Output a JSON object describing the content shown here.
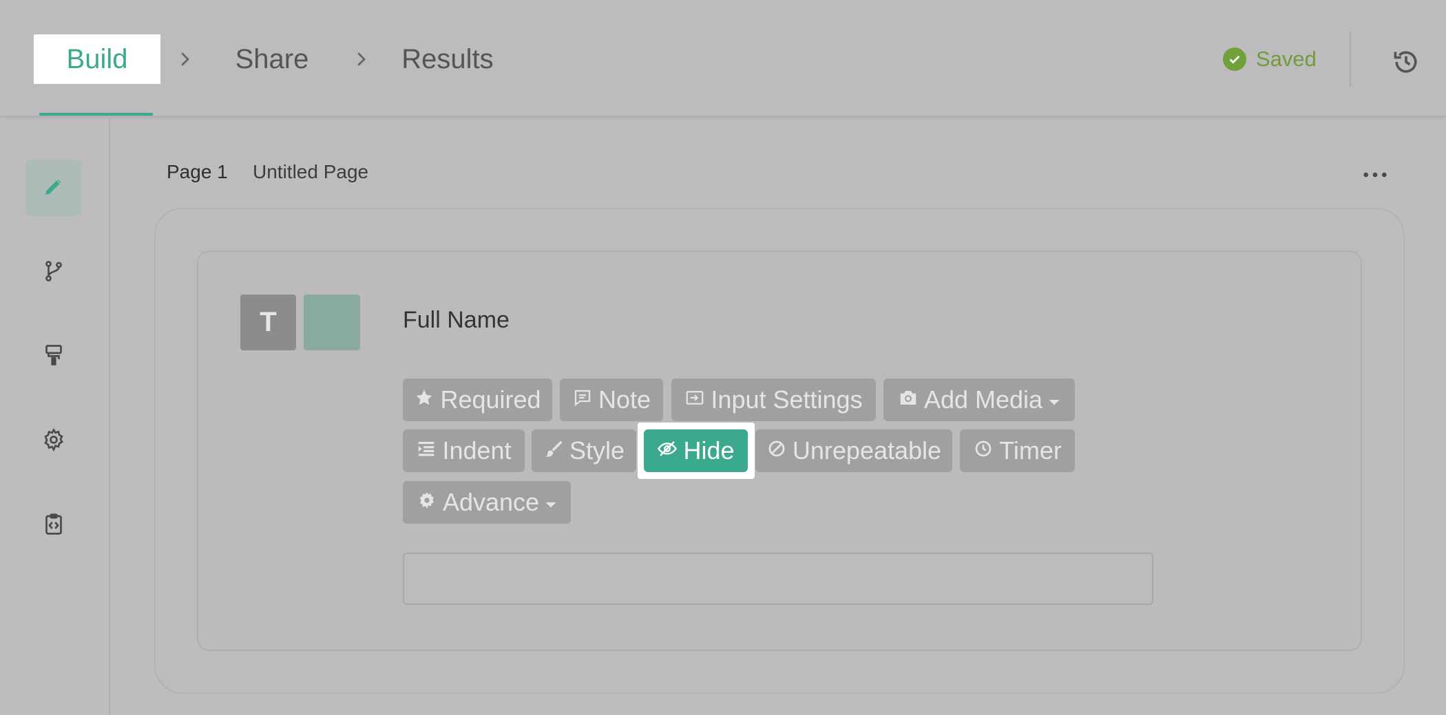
{
  "steps": {
    "build": "Build",
    "share": "Share",
    "results": "Results"
  },
  "status": {
    "saved": "Saved"
  },
  "page": {
    "number_label": "Page 1",
    "title": "Untitled Page"
  },
  "field": {
    "type_letter": "T",
    "label": "Full Name",
    "input_value": ""
  },
  "chips": {
    "required": "Required",
    "note": "Note",
    "input_settings": "Input Settings",
    "add_media": "Add Media",
    "indent": "Indent",
    "style": "Style",
    "hide": "Hide",
    "unrepeatable": "Unrepeatable",
    "timer": "Timer",
    "advance": "Advance"
  },
  "icons": {
    "rail": [
      "pencil-icon",
      "branch-icon",
      "paint-roller-icon",
      "gear-icon",
      "code-clipboard-icon"
    ],
    "saved": "check-circle-icon",
    "history": "history-icon",
    "more": "more-horizontal-icon"
  },
  "colors": {
    "accent": "#3aa98d",
    "saved_green": "#6fa03a",
    "chip_bg": "#a19fa2"
  }
}
